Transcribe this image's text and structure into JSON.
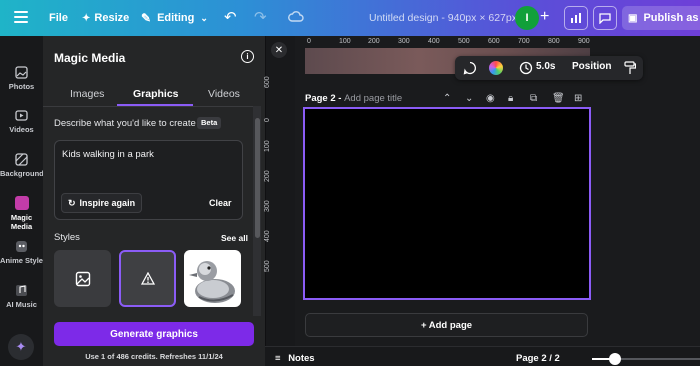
{
  "topbar": {
    "file": "File",
    "resize": "Resize",
    "editing": "Editing",
    "title": "Untitled design - 940px × 627px",
    "avatar_letter": "I",
    "publish": "Publish as Bra"
  },
  "rail": {
    "items": [
      {
        "label": "Photos",
        "icon": "photo-icon"
      },
      {
        "label": "Videos",
        "icon": "video-icon"
      },
      {
        "label": "Background",
        "icon": "background-icon"
      },
      {
        "label": "Magic Media",
        "icon": "magic-media-icon"
      },
      {
        "label": "Anime Style",
        "icon": "anime-style-icon"
      },
      {
        "label": "AI Music",
        "icon": "music-icon"
      }
    ]
  },
  "panel": {
    "title": "Magic Media",
    "tabs": [
      "Images",
      "Graphics",
      "Videos"
    ],
    "active_tab": "Graphics",
    "describe_label": "Describe what you'd like to create",
    "beta": "Beta",
    "prompt": "Kids walking in a park",
    "inspire": "Inspire again",
    "clear": "Clear",
    "styles_label": "Styles",
    "see_all": "See all",
    "generate": "Generate graphics",
    "credits": "Use 1 of 486 credits. Refreshes 11/1/24"
  },
  "canvas": {
    "ruler_top": [
      "0",
      "100",
      "200",
      "300",
      "400",
      "500",
      "600",
      "700",
      "800",
      "900"
    ],
    "ruler_left": [
      "600",
      "0",
      "100",
      "200",
      "300",
      "400",
      "500"
    ],
    "duration": "5.0s",
    "position": "Position",
    "page_label": "Page 2 -",
    "page_title_placeholder": "Add page title",
    "add_page": "+ Add page"
  },
  "bottombar": {
    "notes": "Notes",
    "page_count": "Page 2 / 2",
    "zoom_fraction": 0.21
  },
  "colors": {
    "accent": "#8b5cf6",
    "generate_button": "#7d2ae8",
    "avatar": "#11a03a"
  }
}
